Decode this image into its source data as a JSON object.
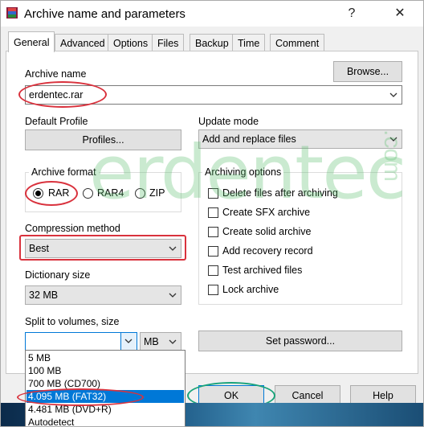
{
  "window": {
    "title": "Archive name and parameters",
    "help_glyph": "?",
    "close_glyph": "✕"
  },
  "tabs": [
    {
      "label": "General"
    },
    {
      "label": "Advanced"
    },
    {
      "label": "Options"
    },
    {
      "label": "Files"
    },
    {
      "label": "Backup"
    },
    {
      "label": "Time"
    },
    {
      "label": "Comment"
    }
  ],
  "archive_name": {
    "label": "Archive name",
    "value": "erdentec.rar",
    "browse_label": "Browse..."
  },
  "default_profile": {
    "label": "Default Profile",
    "button_label": "Profiles..."
  },
  "update_mode": {
    "label": "Update mode",
    "value": "Add and replace files"
  },
  "archive_format": {
    "label": "Archive format",
    "options": [
      "RAR",
      "RAR4",
      "ZIP"
    ],
    "selected": "RAR"
  },
  "archiving_options": {
    "label": "Archiving options",
    "items": [
      {
        "label": "Delete files after archiving",
        "checked": false
      },
      {
        "label": "Create SFX archive",
        "checked": false
      },
      {
        "label": "Create solid archive",
        "checked": false
      },
      {
        "label": "Add recovery record",
        "checked": false
      },
      {
        "label": "Test archived files",
        "checked": false
      },
      {
        "label": "Lock archive",
        "checked": false
      }
    ]
  },
  "compression_method": {
    "label": "Compression method",
    "value": "Best"
  },
  "dictionary_size": {
    "label": "Dictionary size",
    "value": "32 MB"
  },
  "split_volumes": {
    "label": "Split to volumes, size",
    "value": "",
    "unit": "MB",
    "options": [
      "5 MB",
      "100 MB",
      "700 MB  (CD700)",
      "4.095 MB  (FAT32)",
      "4.481 MB  (DVD+R)",
      "Autodetect"
    ],
    "selected_index": 3
  },
  "set_password_label": "Set password...",
  "footer": {
    "ok_label": "OK",
    "cancel_label": "Cancel",
    "help_label": "Help"
  },
  "watermark": {
    "text": "erdentec",
    "suffix": ".com"
  },
  "colors": {
    "highlight_red": "#d9323d",
    "highlight_green": "#1aa37a",
    "selection_blue": "#0078d7"
  }
}
